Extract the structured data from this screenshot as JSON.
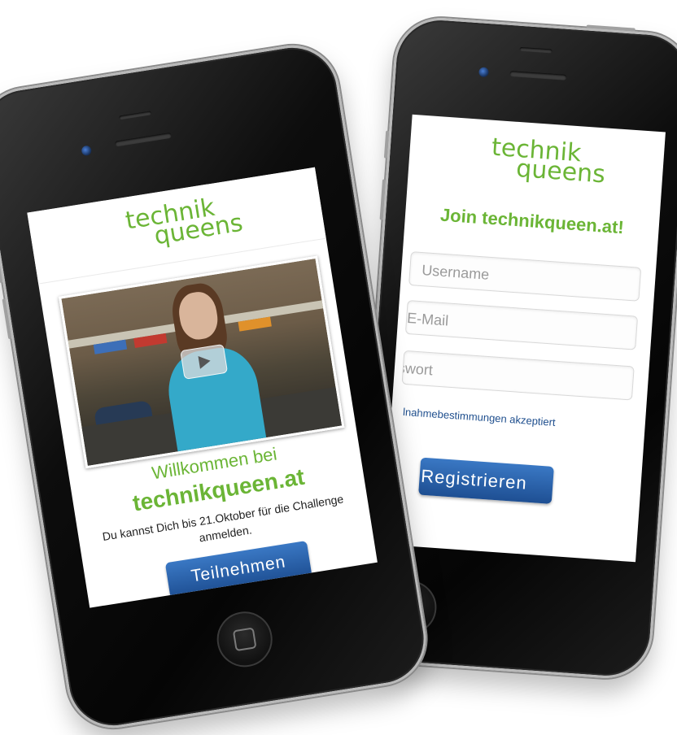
{
  "left_phone": {
    "logo": {
      "line1": "technik",
      "line2": "queens"
    },
    "video": {
      "play_icon": "play-icon"
    },
    "welcome_text": "Willkommen bei",
    "site_name": "technikqueen.at",
    "description": "Du kannst Dich bis 21.Oktober für die Challenge anmelden.",
    "cta_label": "Teilnehmen"
  },
  "right_phone": {
    "logo": {
      "line1": "technik",
      "line2": "queens"
    },
    "title": "Join technikqueen.at!",
    "username_placeholder": "Username",
    "email_placeholder": "E-Mail",
    "password_placeholder": "sswort",
    "terms_text": "lnahmebestimmungen akzeptiert",
    "register_label": "Registrieren"
  },
  "colors": {
    "brand_green": "#6bb536",
    "button_blue": "#2a62ad",
    "link_blue": "#1f4f8e"
  }
}
